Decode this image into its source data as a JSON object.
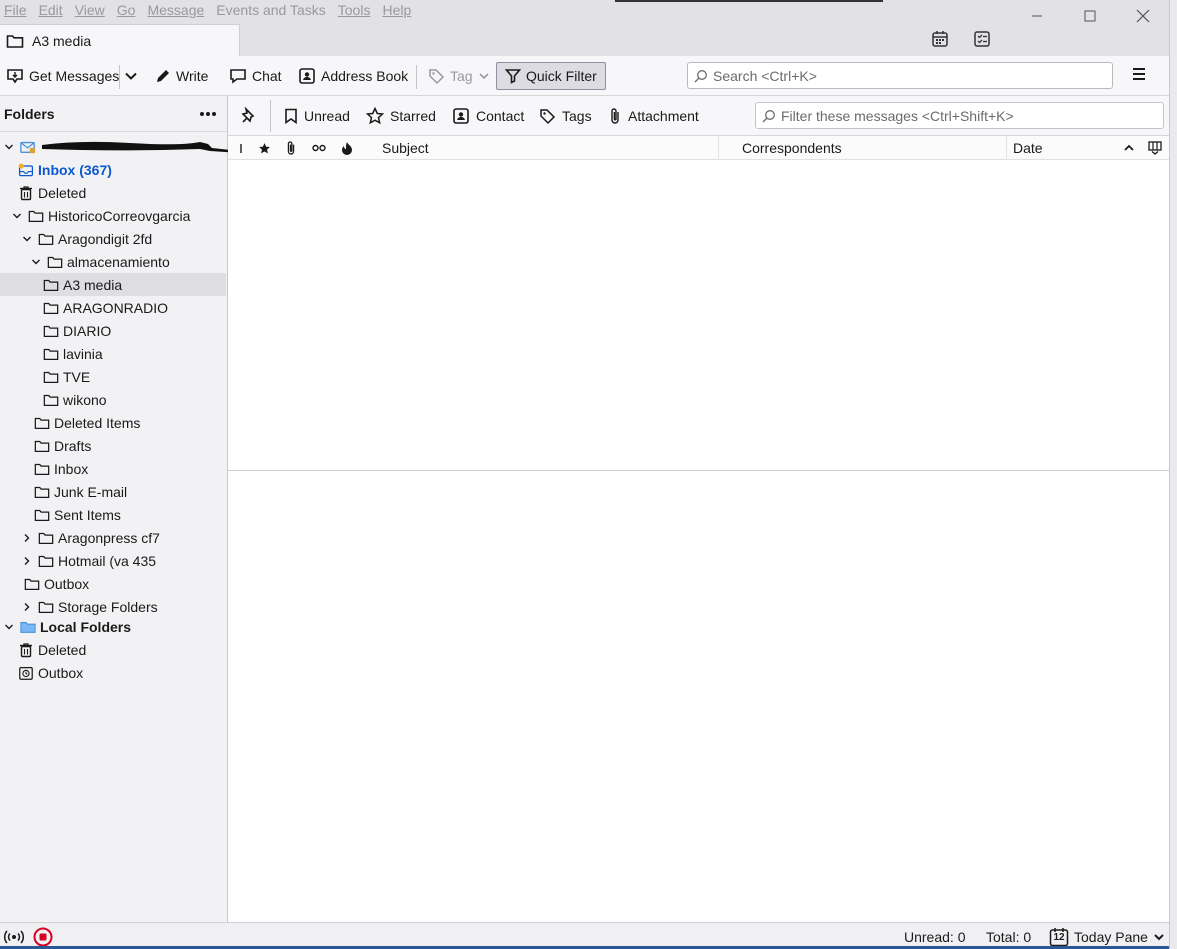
{
  "menu": {
    "file": "File",
    "edit": "Edit",
    "view": "View",
    "go": "Go",
    "message": "Message",
    "events": "Events and Tasks",
    "tools": "Tools",
    "help": "Help"
  },
  "tab": {
    "label": "A3 media"
  },
  "toolbar": {
    "get_messages": "Get Messages",
    "write": "Write",
    "chat": "Chat",
    "address_book": "Address Book",
    "tag": "Tag",
    "quick_filter": "Quick Filter",
    "search_placeholder": "Search <Ctrl+K>"
  },
  "folder_pane": {
    "title": "Folders",
    "local_folders": "Local Folders",
    "folders": [
      {
        "label": "Inbox (367)"
      },
      {
        "label": "Deleted"
      },
      {
        "label": "HistoricoCorreovgarcia"
      },
      {
        "label": "Aragondigit 2fd"
      },
      {
        "label": "almacenamiento"
      },
      {
        "label": "A3 media"
      },
      {
        "label": "ARAGONRADIO"
      },
      {
        "label": "DIARIO"
      },
      {
        "label": "lavinia"
      },
      {
        "label": "TVE"
      },
      {
        "label": "wikono"
      },
      {
        "label": "Deleted Items"
      },
      {
        "label": "Drafts"
      },
      {
        "label": "Inbox"
      },
      {
        "label": "Junk E-mail"
      },
      {
        "label": "Sent Items"
      },
      {
        "label": "Aragonpress cf7"
      },
      {
        "label": "Hotmail (va 435"
      },
      {
        "label": "Outbox"
      },
      {
        "label": "Storage Folders"
      },
      {
        "label": "Deleted"
      },
      {
        "label": "Outbox"
      }
    ]
  },
  "quick_filter_bar": {
    "unread": "Unread",
    "starred": "Starred",
    "contact": "Contact",
    "tags": "Tags",
    "attachment": "Attachment",
    "filter_placeholder": "Filter these messages <Ctrl+Shift+K>"
  },
  "columns": {
    "subject": "Subject",
    "correspondents": "Correspondents",
    "date": "Date"
  },
  "statusbar": {
    "unread": "Unread: 0",
    "total": "Total: 0",
    "today_pane": "Today Pane",
    "calendar_day": "12"
  },
  "colors": {
    "accent_blue": "#0b57d0",
    "folder_blue": "#4a90d9",
    "offline_red": "#d70022"
  }
}
